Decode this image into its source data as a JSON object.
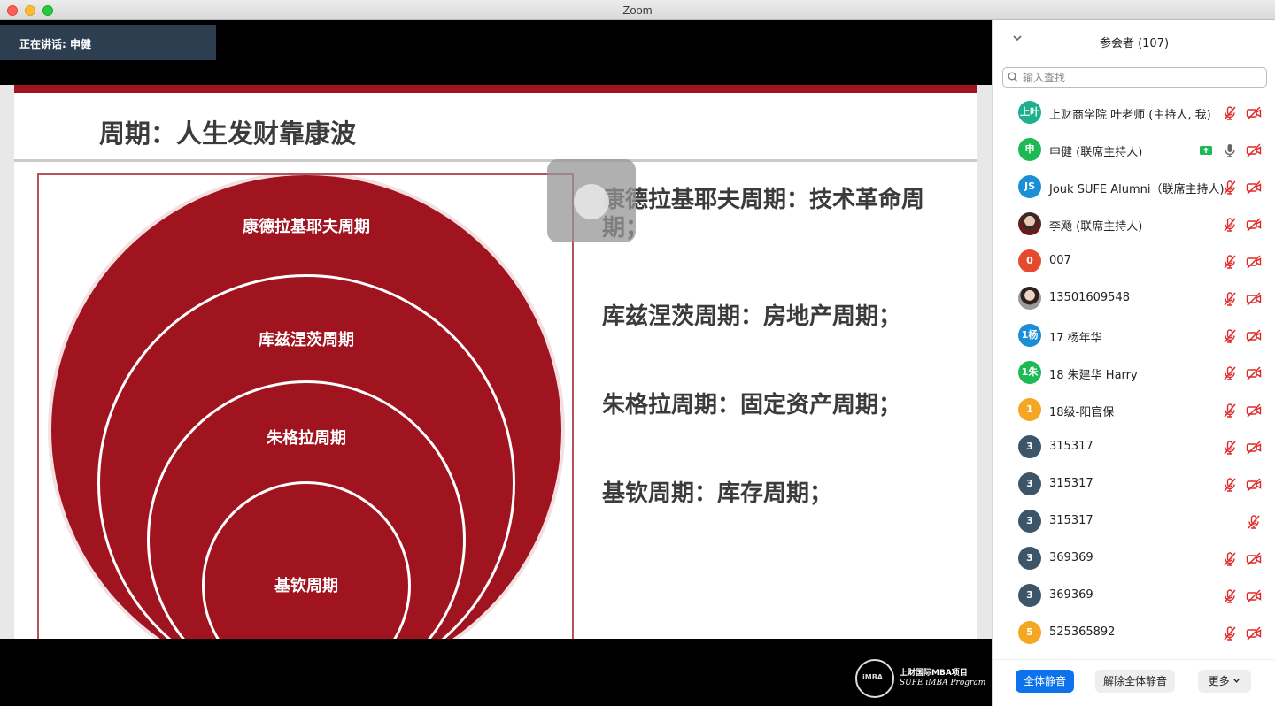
{
  "window": {
    "title": "Zoom"
  },
  "stage": {
    "speaking": "正在讲话: 申健",
    "slide": {
      "title": "周期：人生发财靠康波",
      "circles": [
        "康德拉基耶夫周期",
        "库兹涅茨周期",
        "朱格拉周期",
        "基钦周期"
      ],
      "bullets": [
        "康德拉基耶夫周期：技术革命周期；",
        "库兹涅茨周期：房地产周期；",
        "朱格拉周期：固定资产周期；",
        "基钦周期：库存周期；"
      ]
    },
    "logo": {
      "line1": "上财国际MBA项目",
      "line2": "SUFE iMBA Program"
    }
  },
  "panel": {
    "title": "参会者 (107)",
    "search_placeholder": "输入查找",
    "participants": [
      {
        "avatar": "上叶",
        "color": "#1cb08c",
        "name": "上财商学院 叶老师 (主持人, 我)",
        "video": true
      },
      {
        "avatar": "申",
        "color": "#1db954",
        "name": "申健 (联席主持人)",
        "sharing": true,
        "mic_on": true,
        "video": true
      },
      {
        "avatar": "JS",
        "color": "#1a8fd8",
        "name": "Jouk SUFE Alumni（联席主持人)",
        "video": true
      },
      {
        "avatar": "",
        "photo": "photo",
        "name": "李飏 (联席主持人)",
        "video": true
      },
      {
        "avatar": "0",
        "color": "#e64a2e",
        "name": "007",
        "video": true
      },
      {
        "avatar": "",
        "photo": "photo2",
        "name": "13501609548",
        "video": true
      },
      {
        "avatar": "1杨",
        "color": "#1a8fd8",
        "name": "17 杨年华",
        "video": true
      },
      {
        "avatar": "1朱",
        "color": "#1db954",
        "name": "18 朱建华 Harry",
        "video": true
      },
      {
        "avatar": "1",
        "color": "#f5a623",
        "name": "18级-阳官保",
        "video": true
      },
      {
        "avatar": "3",
        "color": "#3d5568",
        "name": "315317",
        "video": true
      },
      {
        "avatar": "3",
        "color": "#3d5568",
        "name": "315317",
        "video": true
      },
      {
        "avatar": "3",
        "color": "#3d5568",
        "name": "315317",
        "video": false
      },
      {
        "avatar": "3",
        "color": "#3d5568",
        "name": "369369",
        "video": true
      },
      {
        "avatar": "3",
        "color": "#3d5568",
        "name": "369369",
        "video": true
      },
      {
        "avatar": "5",
        "color": "#f5a623",
        "name": "525365892",
        "video": true
      }
    ],
    "footer": {
      "mute_all": "全体静音",
      "unmute_all": "解除全体静音",
      "more": "更多"
    }
  }
}
